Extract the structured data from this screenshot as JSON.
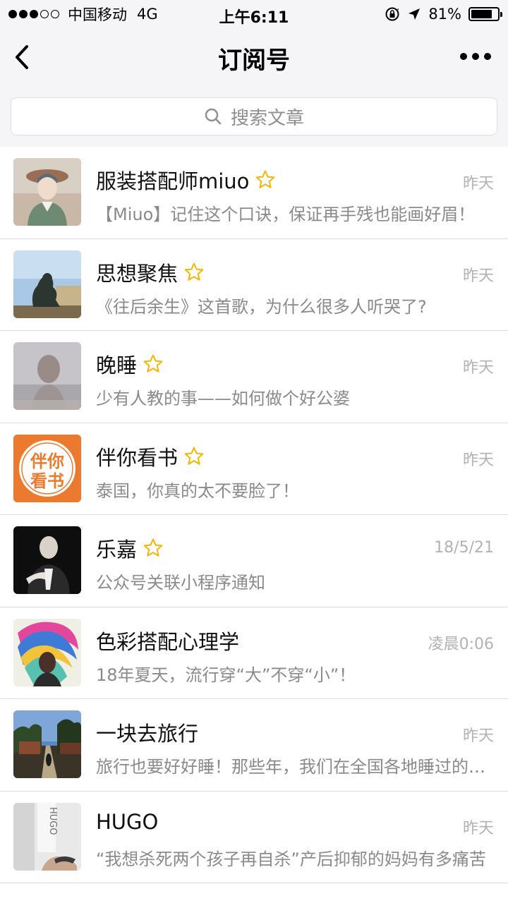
{
  "status_bar": {
    "carrier": "中国移动",
    "network": "4G",
    "time": "上午6:11",
    "battery_percent": "81%",
    "battery_level": 0.81
  },
  "nav": {
    "title": "订阅号",
    "back_icon": "chevron-left-icon",
    "more_icon": "more-dots-icon"
  },
  "search": {
    "placeholder": "搜索文章",
    "icon": "search-icon"
  },
  "colors": {
    "star": "#f7b500",
    "timestamp": "#b2b2b2",
    "preview": "#8a8a8a",
    "header_bg": "#f5f5f7"
  },
  "subscriptions": [
    {
      "name": "服装搭配师miuo",
      "starred": true,
      "time": "昨天",
      "preview": "【Miuo】记住这个口诀，保证再手残也能画好眉！"
    },
    {
      "name": "思想聚焦",
      "starred": true,
      "time": "昨天",
      "preview": "《往后余生》这首歌，为什么很多人听哭了?"
    },
    {
      "name": "晚睡",
      "starred": true,
      "time": "昨天",
      "preview": "少有人教的事——如何做个好公婆"
    },
    {
      "name": "伴你看书",
      "starred": true,
      "time": "昨天",
      "preview": "泰国，你真的太不要脸了！",
      "avatar_text": [
        "伴你",
        "看书"
      ]
    },
    {
      "name": "乐嘉",
      "starred": true,
      "time": "18/5/21",
      "preview": "公众号关联小程序通知"
    },
    {
      "name": "色彩搭配心理学",
      "starred": false,
      "time": "凌晨0:06",
      "preview": "18年夏天，流行穿“大”不穿“小”！"
    },
    {
      "name": "一块去旅行",
      "starred": false,
      "time": "昨天",
      "preview": "旅行也要好好睡！那些年，我们在全国各地睡过的酒店"
    },
    {
      "name": "HUGO",
      "starred": false,
      "time": "昨天",
      "preview": "“我想杀死两个孩子再自杀”产后抑郁的妈妈有多痛苦",
      "avatar_text": [
        "HUGO"
      ]
    }
  ]
}
